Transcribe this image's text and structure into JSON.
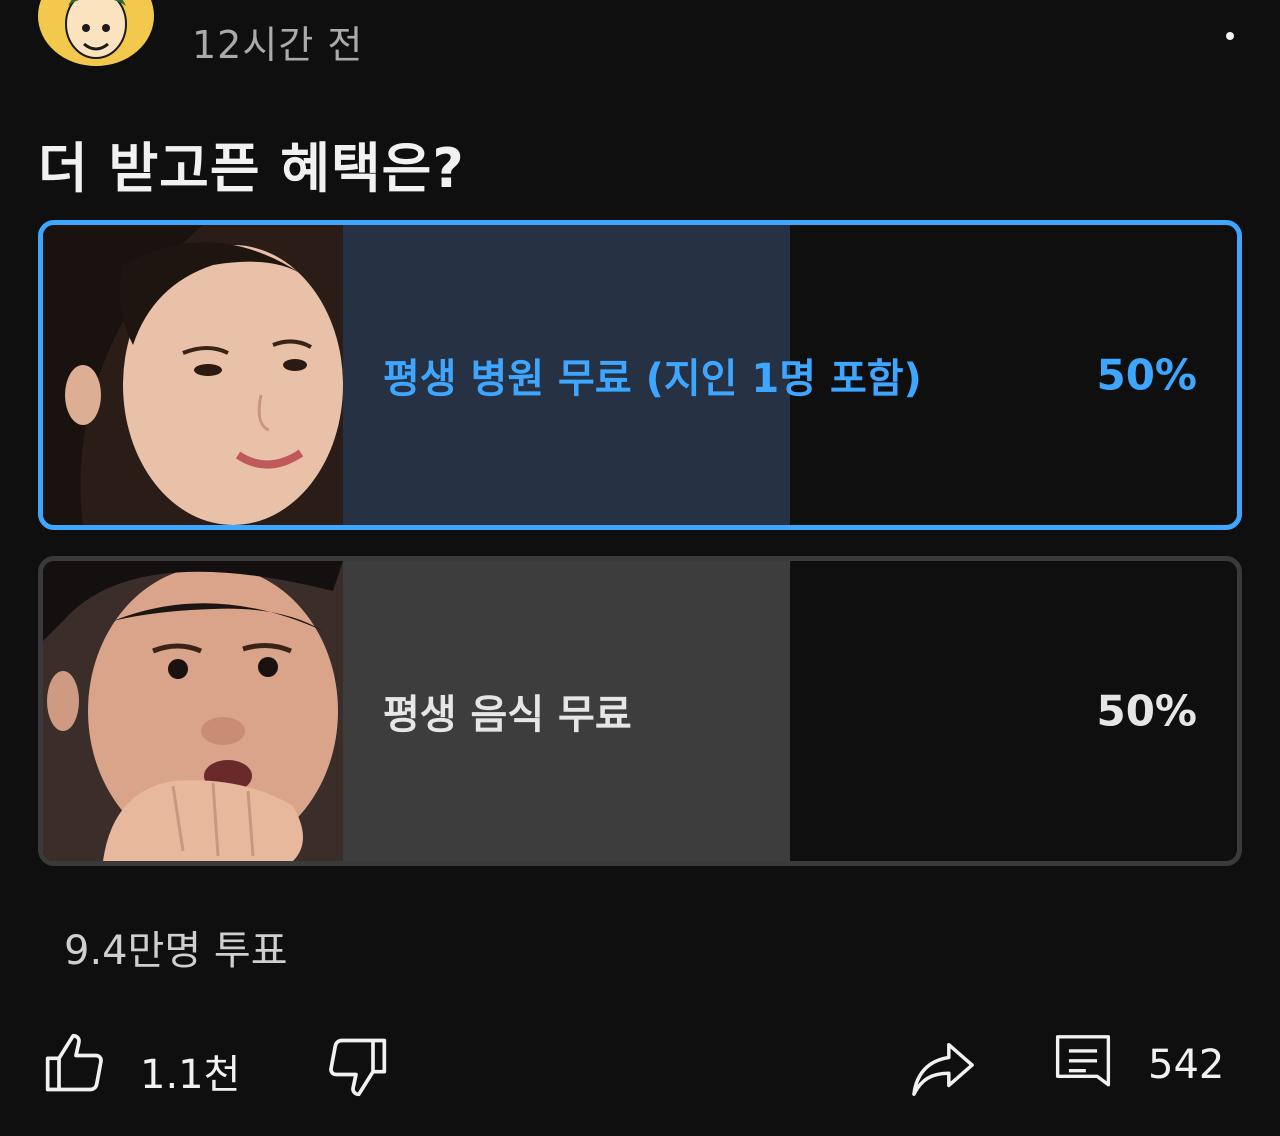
{
  "post": {
    "timestamp": "12시간 전",
    "question": "더 받고픈 혜택은?"
  },
  "poll": {
    "options": [
      {
        "label": "평생 병원 무료 (지인 1명 포함)",
        "percent_label": "50%",
        "percent": 50,
        "selected": true
      },
      {
        "label": "평생 음식 무료",
        "percent_label": "50%",
        "percent": 50,
        "selected": false
      }
    ],
    "votes": "9.4만명 투표"
  },
  "actions": {
    "like_count": "1.1천",
    "comment_count": "542"
  },
  "colors": {
    "accent": "#3ea6ff",
    "background": "#0f0f0f",
    "selected_fill": "#263143",
    "unselected_fill": "#3d3d3d"
  }
}
